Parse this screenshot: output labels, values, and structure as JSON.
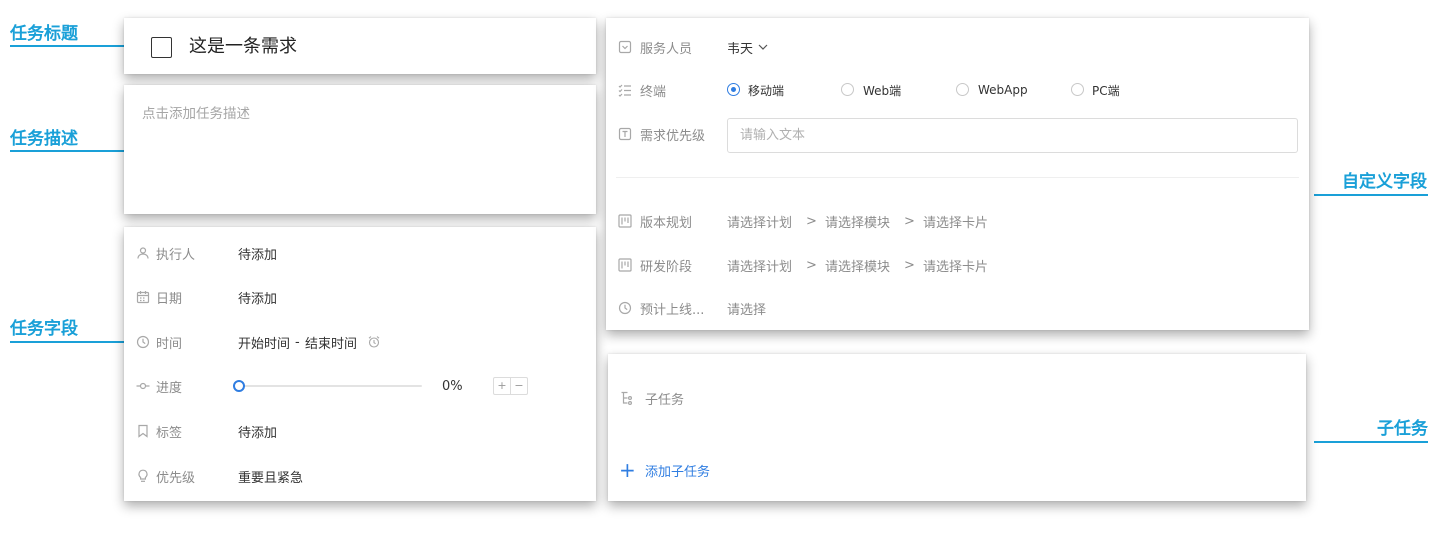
{
  "annotations": {
    "task_title": "任务标题",
    "task_description": "任务描述",
    "task_fields": "任务字段",
    "custom_fields": "自定义字段",
    "subtasks": "子任务"
  },
  "task": {
    "title": "这是一条需求",
    "description_placeholder": "点击添加任务描述"
  },
  "fields": {
    "assignee": {
      "label": "执行人",
      "value": "待添加"
    },
    "date": {
      "label": "日期",
      "value": "待添加"
    },
    "time": {
      "label": "时间",
      "start": "开始时间",
      "separator": "-",
      "end": "结束时间"
    },
    "progress": {
      "label": "进度",
      "value_text": "0%",
      "value": 0,
      "plus": "+",
      "minus": "−"
    },
    "tags": {
      "label": "标签",
      "value": "待添加"
    },
    "priority": {
      "label": "优先级",
      "value": "重要且紧急"
    }
  },
  "custom": {
    "service_person": {
      "label": "服务人员",
      "value": "韦天"
    },
    "terminal": {
      "label": "终端",
      "options": [
        "移动端",
        "Web端",
        "WebApp",
        "PC端"
      ],
      "selected": "移动端"
    },
    "req_priority": {
      "label": "需求优先级",
      "placeholder": "请输入文本"
    },
    "version_plan": {
      "label": "版本规划",
      "plan": "请选择计划",
      "module": "请选择模块",
      "card": "请选择卡片",
      "sep": ">"
    },
    "dev_stage": {
      "label": "研发阶段",
      "plan": "请选择计划",
      "module": "请选择模块",
      "card": "请选择卡片",
      "sep": ">"
    },
    "expected_launch": {
      "label": "预计上线...",
      "value": "请选择"
    }
  },
  "subtask": {
    "header": "子任务",
    "add_label": "添加子任务",
    "add_icon": "+"
  },
  "colors": {
    "annotation": "#1aa0d8",
    "accent": "#2f7de1"
  }
}
